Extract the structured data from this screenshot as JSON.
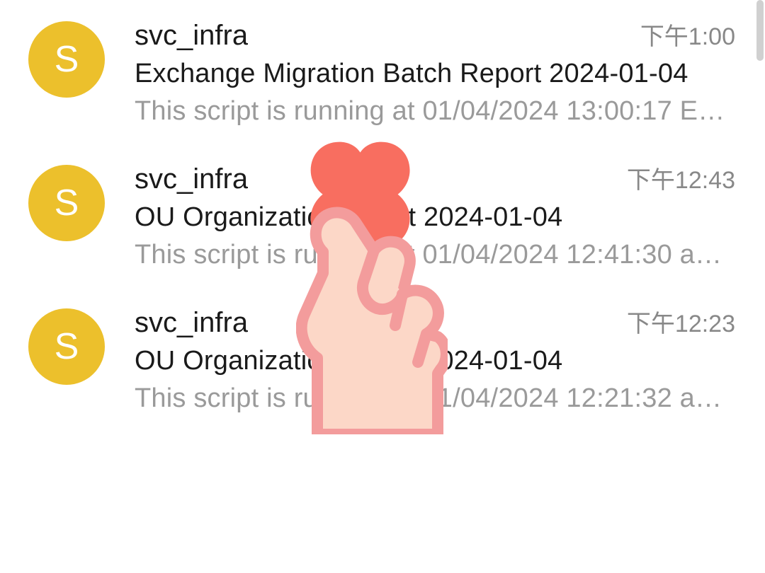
{
  "colors": {
    "avatar_bg": "#ecc02c",
    "heart_fill": "#f86e60",
    "hand_fill": "#fcd7c7",
    "hand_stroke": "#f39c9c"
  },
  "avatar_initial": "S",
  "emails": [
    {
      "sender": "svc_infra",
      "time": "下午1:00",
      "subject": "Exchange Migration Batch Report 2024-01-04",
      "preview": "This script is running at 01/04/2024 13:00:17 E…"
    },
    {
      "sender": "svc_infra",
      "time": "下午12:43",
      "subject": "OU Organization report 2024-01-04",
      "preview": "This script is running at 01/04/2024 12:41:30 a…"
    },
    {
      "sender": "svc_infra",
      "time": "下午12:23",
      "subject": "OU Organization report 2024-01-04",
      "preview": "This script is running at 01/04/2024 12:21:32 a…"
    }
  ],
  "sticker_name": "finger-heart-sticker"
}
